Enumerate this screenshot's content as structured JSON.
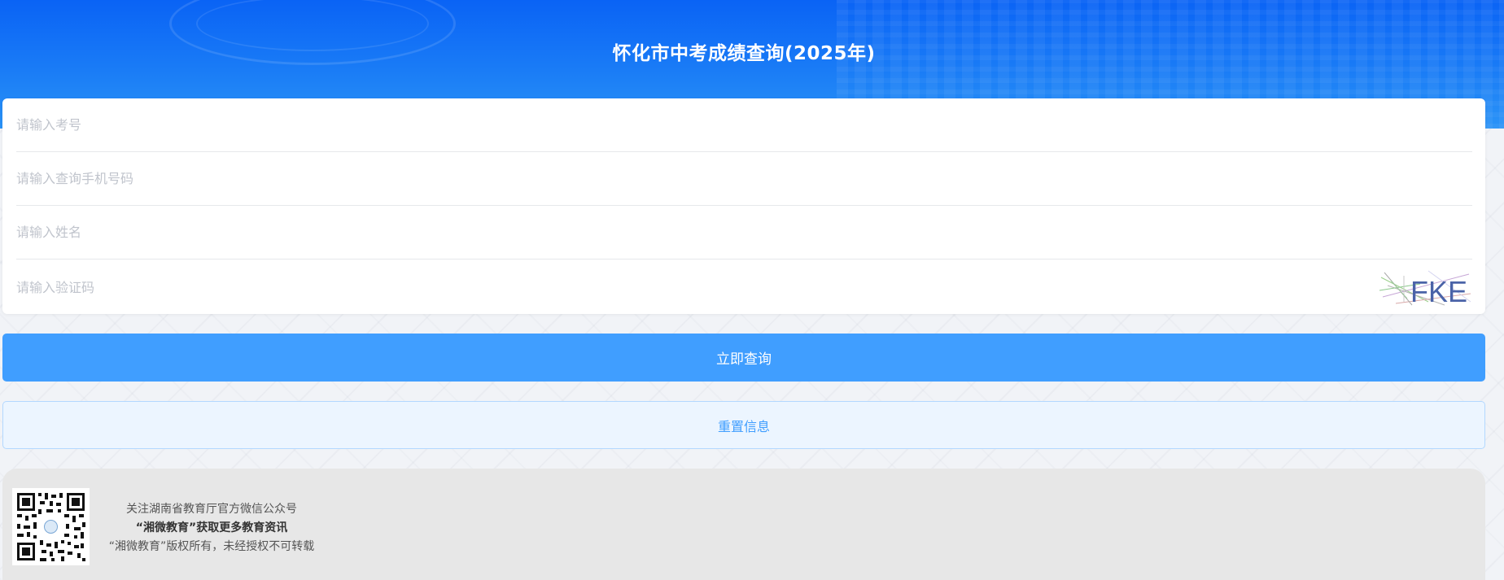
{
  "header": {
    "title": "怀化市中考成绩查询(2025年)"
  },
  "form": {
    "exam_number_placeholder": "请输入考号",
    "phone_placeholder": "请输入查询手机号码",
    "name_placeholder": "请输入姓名",
    "captcha_placeholder": "请输入验证码",
    "captcha_text": "FKE"
  },
  "buttons": {
    "query_label": "立即查询",
    "reset_label": "重置信息"
  },
  "footer": {
    "line1": "关注湖南省教育厅官方微信公众号",
    "line2": "“湘微教育”获取更多教育资讯",
    "line3": "“湘微教育”版权所有，未经授权不可转载"
  },
  "colors": {
    "header_blue": "#0a63f5",
    "primary": "#409eff",
    "secondary_bg": "#ecf5ff"
  },
  "icons": {
    "qr": "qr-code-icon",
    "captcha": "captcha-image"
  }
}
